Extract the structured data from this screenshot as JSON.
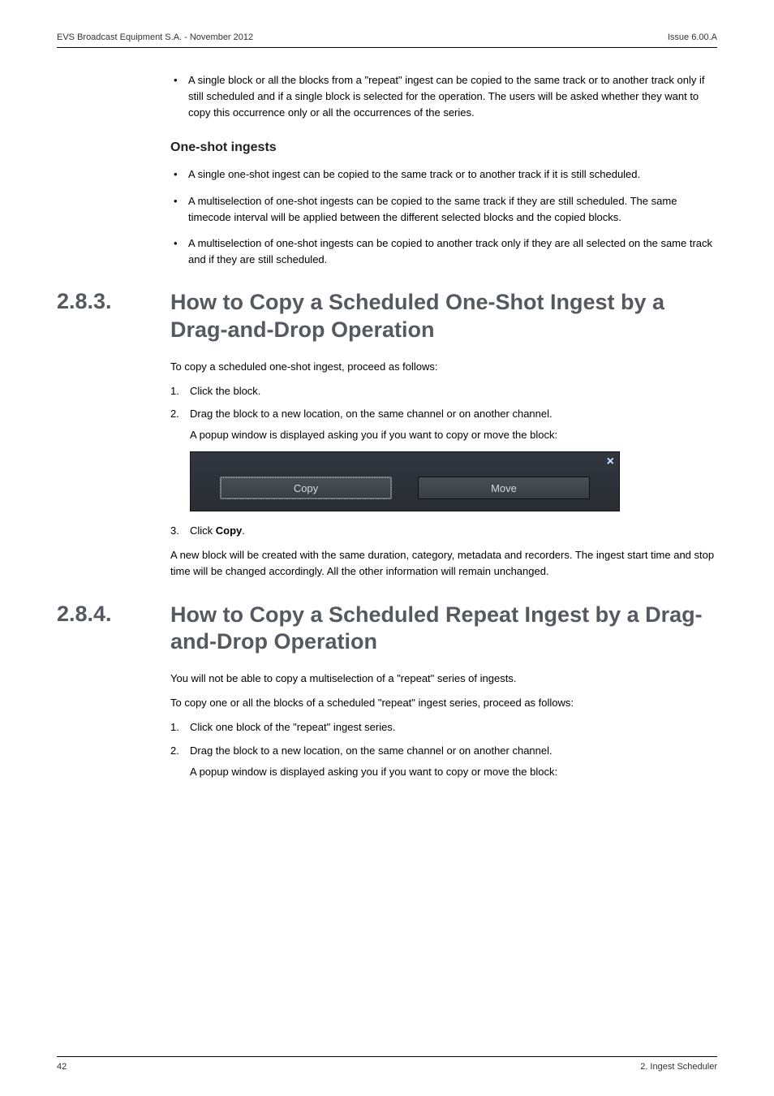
{
  "header": {
    "left": "EVS Broadcast Equipment S.A. - November 2012",
    "right": "Issue 6.00.A"
  },
  "intro_bullets": [
    "A single block or all the blocks from a \"repeat\" ingest can be copied to the same track or to another track only if still scheduled and if a single block is selected for the operation. The users will be asked whether they want to copy this occurrence only or all the occurrences of the series."
  ],
  "oneshot": {
    "heading": "One-shot ingests",
    "bullets": [
      "A single one-shot ingest can be copied to the same track or to another track if it is still scheduled.",
      "A multiselection of one-shot ingests can be copied to the same track if they are still scheduled. The same timecode interval will be applied between the different selected blocks and the copied blocks.",
      "A multiselection of one-shot ingests can be copied to another track only if they are all selected on the same track and if they are still scheduled."
    ]
  },
  "section_283": {
    "number": "2.8.3.",
    "title": "How to Copy a Scheduled One-Shot Ingest by a Drag-and-Drop Operation",
    "lead": "To copy a scheduled one-shot ingest, proceed as follows:",
    "step1": "Click the block.",
    "step2": "Drag the block to a new location, on the same channel or on another channel.",
    "step2_sub": "A popup window is displayed asking you if you want to copy or move the block:",
    "popup": {
      "copy": "Copy",
      "move": "Move"
    },
    "step3_prefix": "Click ",
    "step3_bold": "Copy",
    "step3_suffix": ".",
    "after": "A new block will be created with the same duration, category, metadata and recorders. The ingest start time and stop time will be changed accordingly. All the other information will remain unchanged."
  },
  "section_284": {
    "number": "2.8.4.",
    "title": "How to Copy a Scheduled Repeat Ingest by a Drag-and-Drop Operation",
    "p1": "You will not be able to copy a multiselection of a \"repeat\" series of ingests.",
    "p2": "To copy one or all the blocks of a scheduled \"repeat\" ingest series, proceed as follows:",
    "step1": "Click one block of the \"repeat\" ingest series.",
    "step2": "Drag the block to a new location, on the same channel or on another channel.",
    "step2_sub": "A popup window is displayed asking you if you want to copy or move the block:"
  },
  "footer": {
    "left": "42",
    "right": "2. Ingest Scheduler"
  }
}
